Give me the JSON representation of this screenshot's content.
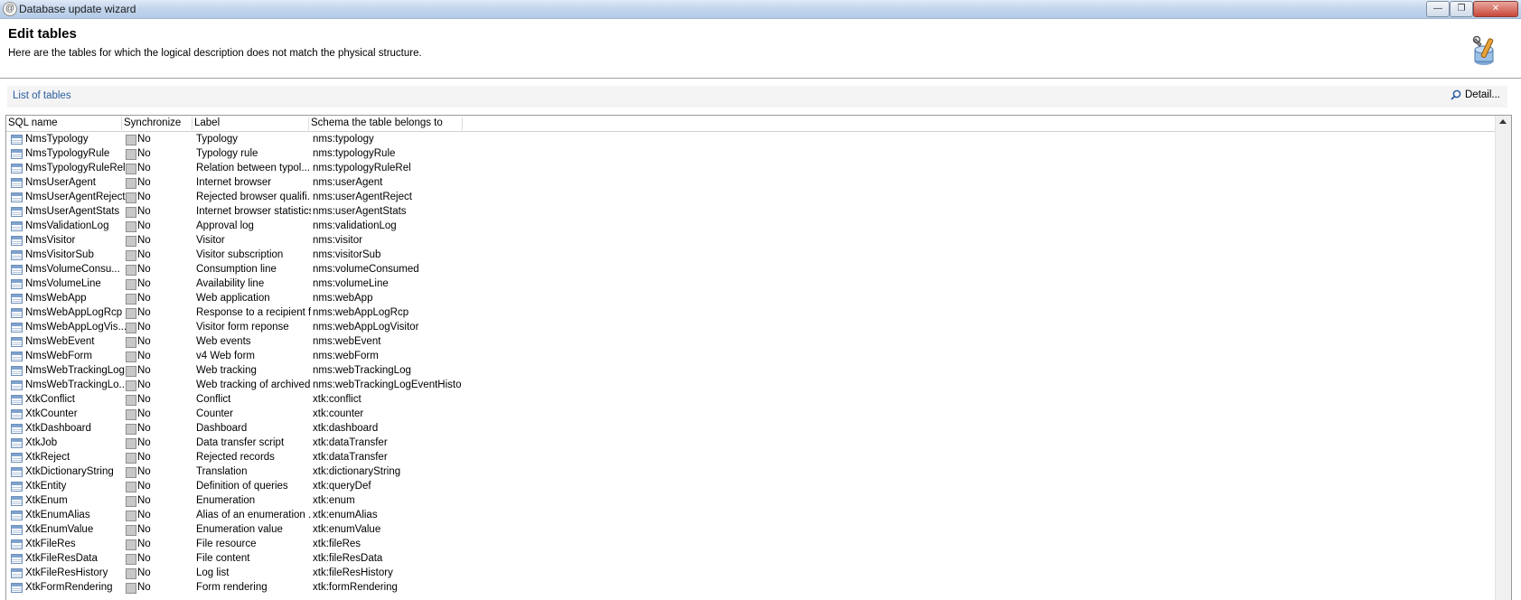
{
  "window": {
    "title": "Database update wizard",
    "min_glyph": "—",
    "max_glyph": "❐",
    "close_glyph": "✕"
  },
  "header": {
    "title": "Edit tables",
    "subtitle": "Here are the tables for which the logical description does not match the physical structure."
  },
  "listbar": {
    "label": "List of tables",
    "detail_label": "Detail..."
  },
  "columns": [
    "SQL name",
    "Synchronize",
    "Label",
    "Schema the table belongs to"
  ],
  "rows": [
    {
      "name": "NmsTypology",
      "sync": "No",
      "label": "Typology",
      "schema": "nms:typology"
    },
    {
      "name": "NmsTypologyRule",
      "sync": "No",
      "label": "Typology rule",
      "schema": "nms:typologyRule"
    },
    {
      "name": "NmsTypologyRuleRel",
      "sync": "No",
      "label": "Relation between typol...",
      "schema": "nms:typologyRuleRel"
    },
    {
      "name": "NmsUserAgent",
      "sync": "No",
      "label": "Internet browser",
      "schema": "nms:userAgent"
    },
    {
      "name": "NmsUserAgentReject",
      "sync": "No",
      "label": "Rejected browser qualifi...",
      "schema": "nms:userAgentReject"
    },
    {
      "name": "NmsUserAgentStats",
      "sync": "No",
      "label": "Internet browser statistics",
      "schema": "nms:userAgentStats"
    },
    {
      "name": "NmsValidationLog",
      "sync": "No",
      "label": "Approval log",
      "schema": "nms:validationLog"
    },
    {
      "name": "NmsVisitor",
      "sync": "No",
      "label": "Visitor",
      "schema": "nms:visitor"
    },
    {
      "name": "NmsVisitorSub",
      "sync": "No",
      "label": "Visitor subscription",
      "schema": "nms:visitorSub"
    },
    {
      "name": "NmsVolumeConsu...",
      "sync": "No",
      "label": "Consumption line",
      "schema": "nms:volumeConsumed"
    },
    {
      "name": "NmsVolumeLine",
      "sync": "No",
      "label": "Availability line",
      "schema": "nms:volumeLine"
    },
    {
      "name": "NmsWebApp",
      "sync": "No",
      "label": "Web application",
      "schema": "nms:webApp"
    },
    {
      "name": "NmsWebAppLogRcp",
      "sync": "No",
      "label": "Response to a recipient f...",
      "schema": "nms:webAppLogRcp"
    },
    {
      "name": "NmsWebAppLogVis...",
      "sync": "No",
      "label": "Visitor form reponse",
      "schema": "nms:webAppLogVisitor"
    },
    {
      "name": "NmsWebEvent",
      "sync": "No",
      "label": "Web events",
      "schema": "nms:webEvent"
    },
    {
      "name": "NmsWebForm",
      "sync": "No",
      "label": "v4 Web form",
      "schema": "nms:webForm"
    },
    {
      "name": "NmsWebTrackingLog",
      "sync": "No",
      "label": "Web tracking",
      "schema": "nms:webTrackingLog"
    },
    {
      "name": "NmsWebTrackingLo...",
      "sync": "No",
      "label": "Web tracking of archived",
      "schema": "nms:webTrackingLogEventHisto"
    },
    {
      "name": "XtkConflict",
      "sync": "No",
      "label": "Conflict",
      "schema": "xtk:conflict"
    },
    {
      "name": "XtkCounter",
      "sync": "No",
      "label": "Counter",
      "schema": "xtk:counter"
    },
    {
      "name": "XtkDashboard",
      "sync": "No",
      "label": "Dashboard",
      "schema": "xtk:dashboard"
    },
    {
      "name": "XtkJob",
      "sync": "No",
      "label": "Data transfer script",
      "schema": "xtk:dataTransfer"
    },
    {
      "name": "XtkReject",
      "sync": "No",
      "label": "Rejected records",
      "schema": "xtk:dataTransfer"
    },
    {
      "name": "XtkDictionaryString",
      "sync": "No",
      "label": "Translation",
      "schema": "xtk:dictionaryString"
    },
    {
      "name": "XtkEntity",
      "sync": "No",
      "label": "Definition of queries",
      "schema": "xtk:queryDef"
    },
    {
      "name": "XtkEnum",
      "sync": "No",
      "label": "Enumeration",
      "schema": "xtk:enum"
    },
    {
      "name": "XtkEnumAlias",
      "sync": "No",
      "label": "Alias of an enumeration ...",
      "schema": "xtk:enumAlias"
    },
    {
      "name": "XtkEnumValue",
      "sync": "No",
      "label": "Enumeration value",
      "schema": "xtk:enumValue"
    },
    {
      "name": "XtkFileRes",
      "sync": "No",
      "label": "File resource",
      "schema": "xtk:fileRes"
    },
    {
      "name": "XtkFileResData",
      "sync": "No",
      "label": "File content",
      "schema": "xtk:fileResData"
    },
    {
      "name": "XtkFileResHistory",
      "sync": "No",
      "label": "Log list",
      "schema": "xtk:fileResHistory"
    },
    {
      "name": "XtkFormRendering",
      "sync": "No",
      "label": "Form rendering",
      "schema": "xtk:formRendering"
    }
  ]
}
